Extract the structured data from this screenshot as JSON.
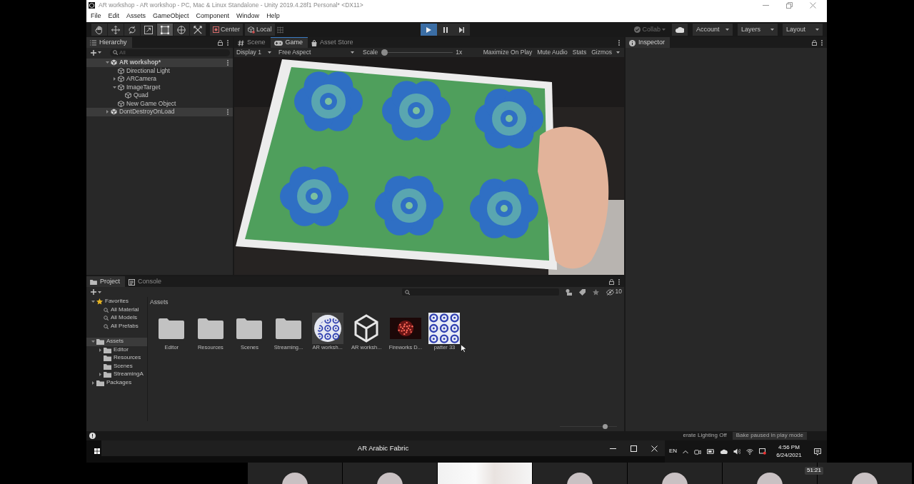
{
  "window": {
    "title": "AR workshop - AR workshop - PC, Mac & Linux Standalone - Unity 2019.4.28f1 Personal* <DX11>"
  },
  "menu": [
    "File",
    "Edit",
    "Assets",
    "GameObject",
    "Component",
    "Window",
    "Help"
  ],
  "toolbar": {
    "tools": [
      {
        "selected": false
      },
      {
        "selected": false
      },
      {
        "selected": false
      },
      {
        "selected": false
      },
      {
        "selected": true
      },
      {
        "selected": false
      },
      {
        "selected": false
      }
    ],
    "pivot": [
      "Center",
      "Local"
    ],
    "play": {
      "playing": true
    },
    "collab": {
      "label": "Collab",
      "disabled": true
    },
    "dropdowns": [
      "Account",
      "Layers",
      "Layout"
    ]
  },
  "hierarchy": {
    "title": "Hierarchy",
    "search": {
      "placeholder": "All"
    },
    "tree": [
      {
        "label": "AR workshop*",
        "kind": "scene",
        "active": true,
        "expanded": true,
        "children": [
          {
            "label": "Directional Light",
            "kind": "object"
          },
          {
            "label": "ARCamera",
            "kind": "object",
            "expanded": false
          },
          {
            "label": "ImageTarget",
            "kind": "object",
            "expanded": true,
            "children": [
              {
                "label": "Quad",
                "kind": "object"
              }
            ]
          },
          {
            "label": "New Game Object",
            "kind": "object"
          }
        ]
      },
      {
        "label": "DontDestroyOnLoad",
        "kind": "scene",
        "active": false,
        "expanded": false
      }
    ]
  },
  "game_view": {
    "tabs": [
      {
        "label": "Scene",
        "selected": false
      },
      {
        "label": "Game",
        "selected": true
      },
      {
        "label": "Asset Store",
        "selected": false
      }
    ],
    "display": "Display 1",
    "aspect": "Free Aspect",
    "scale": {
      "label": "Scale",
      "level": 0,
      "reading": "1x"
    },
    "options": [
      "Maximize On Play",
      "Mute Audio",
      "Stats",
      "Gizmos"
    ]
  },
  "inspector": {
    "title": "Inspector"
  },
  "project": {
    "tabs": [
      {
        "label": "Project",
        "selected": true
      },
      {
        "label": "Console",
        "selected": false
      }
    ],
    "filter_count": "10",
    "sidebar": [
      {
        "label": "Favorites",
        "kind": "favorites",
        "expanded": true,
        "selected": false,
        "children": [
          {
            "label": "All Material",
            "kind": "search",
            "selected": false
          },
          {
            "label": "All Models",
            "kind": "search",
            "selected": false
          },
          {
            "label": "All Prefabs",
            "kind": "search",
            "selected": false
          }
        ]
      },
      {
        "label": "Assets",
        "kind": "folder",
        "expanded": true,
        "selected": true,
        "children": [
          {
            "label": "Editor",
            "kind": "folder",
            "expanded": false,
            "selected": false
          },
          {
            "label": "Resources",
            "kind": "folder",
            "selected": false
          },
          {
            "label": "Scenes",
            "kind": "folder",
            "selected": false
          },
          {
            "label": "StreamingA",
            "kind": "folder",
            "expanded": false,
            "selected": false
          }
        ]
      },
      {
        "label": "Packages",
        "kind": "folder",
        "expanded": false,
        "selected": false
      }
    ],
    "breadcrumb": "Assets",
    "assets": [
      {
        "label": "Editor",
        "kind": "folder"
      },
      {
        "label": "Resources",
        "kind": "folder"
      },
      {
        "label": "Scenes",
        "kind": "folder"
      },
      {
        "label": "Streaming...",
        "kind": "folder"
      },
      {
        "label": "AR worksh...",
        "kind": "material"
      },
      {
        "label": "AR worksh...",
        "kind": "scene"
      },
      {
        "label": "Fireworks D...",
        "kind": "video"
      },
      {
        "label": "patter 33",
        "kind": "texture"
      }
    ],
    "icon_size": {
      "level": 0.82
    }
  },
  "status_bar": {
    "messages": [
      "erate Lighting Off",
      "Bake paused in play mode"
    ]
  },
  "meeting": {
    "title": "AR Arabic Fabric",
    "timer": "51:21",
    "tiles": [
      {
        "kind": "avatar"
      },
      {
        "kind": "avatar"
      },
      {
        "kind": "screen"
      },
      {
        "kind": "avatar"
      },
      {
        "kind": "avatar"
      },
      {
        "kind": "avatar"
      },
      {
        "kind": "avatar"
      }
    ]
  },
  "taskbar": {
    "language": "EN",
    "time": "4:56 PM",
    "date": "6/24/2021"
  }
}
